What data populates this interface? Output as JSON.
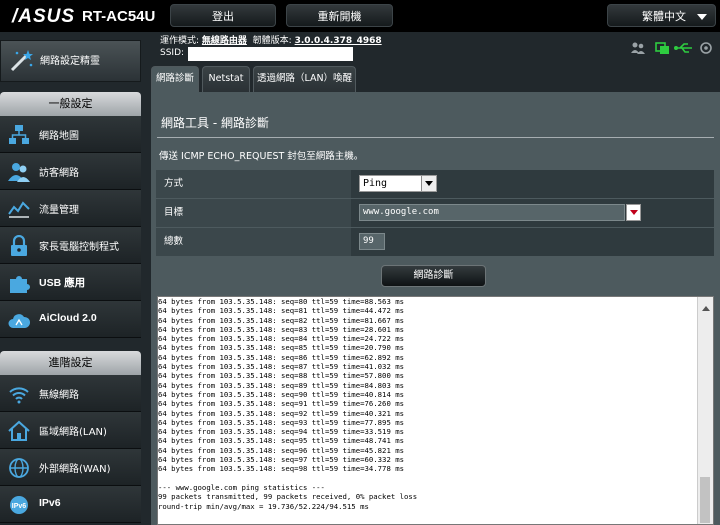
{
  "header": {
    "logo": "/ASUS",
    "model": "RT-AC54U",
    "logout_label": "登出",
    "reboot_label": "重新開機",
    "language": "繁體中文"
  },
  "info": {
    "mode_label": "運作模式:",
    "mode_value": "無線路由器",
    "firmware_label": "韌體版本:",
    "firmware_value": "3.0.0.4.378_4968",
    "ssid_label": "SSID:"
  },
  "sidebar": {
    "qis_label": "網路設定精靈",
    "general_header": "一般設定",
    "general_items": [
      {
        "label": "網路地圖",
        "icon": "network-map-icon"
      },
      {
        "label": "訪客網路",
        "icon": "guest-network-icon"
      },
      {
        "label": "流量管理",
        "icon": "traffic-manager-icon"
      },
      {
        "label": "家長電腦控制程式",
        "icon": "parental-control-icon"
      },
      {
        "label": "USB 應用",
        "icon": "usb-puzzle-icon"
      },
      {
        "label": "AiCloud 2.0",
        "icon": "aicloud-icon"
      }
    ],
    "advanced_header": "進階設定",
    "advanced_items": [
      {
        "label": "無線網路",
        "icon": "wireless-icon"
      },
      {
        "label": "區域網路(LAN)",
        "icon": "home-lan-icon"
      },
      {
        "label": "外部網路(WAN)",
        "icon": "globe-wan-icon"
      },
      {
        "label": "IPv6",
        "icon": "ipv6-icon"
      }
    ]
  },
  "tabs": [
    "網路診斷",
    "Netstat",
    "透過網路（LAN）喚醒"
  ],
  "main": {
    "title": "網路工具 - 網路診斷",
    "description": "傳送 ICMP ECHO_REQUEST 封包至網路主機。",
    "method_label": "方式",
    "method_value": "Ping",
    "target_label": "目標",
    "target_value": "www.google.com",
    "count_label": "總數",
    "count_value": "99",
    "diagnose_button": "網路診斷"
  },
  "console_lines": [
    "64 bytes from 103.5.35.148: seq=80 ttl=59 time=88.563 ms",
    "64 bytes from 103.5.35.148: seq=81 ttl=59 time=44.472 ms",
    "64 bytes from 103.5.35.148: seq=82 ttl=59 time=81.667 ms",
    "64 bytes from 103.5.35.148: seq=83 ttl=59 time=28.601 ms",
    "64 bytes from 103.5.35.148: seq=84 ttl=59 time=24.722 ms",
    "64 bytes from 103.5.35.148: seq=85 ttl=59 time=20.790 ms",
    "64 bytes from 103.5.35.148: seq=86 ttl=59 time=62.892 ms",
    "64 bytes from 103.5.35.148: seq=87 ttl=59 time=41.032 ms",
    "64 bytes from 103.5.35.148: seq=88 ttl=59 time=57.800 ms",
    "64 bytes from 103.5.35.148: seq=89 ttl=59 time=84.803 ms",
    "64 bytes from 103.5.35.148: seq=90 ttl=59 time=40.814 ms",
    "64 bytes from 103.5.35.148: seq=91 ttl=59 time=76.260 ms",
    "64 bytes from 103.5.35.148: seq=92 ttl=59 time=40.321 ms",
    "64 bytes from 103.5.35.148: seq=93 ttl=59 time=77.895 ms",
    "64 bytes from 103.5.35.148: seq=94 ttl=59 time=33.519 ms",
    "64 bytes from 103.5.35.148: seq=95 ttl=59 time=48.741 ms",
    "64 bytes from 103.5.35.148: seq=96 ttl=59 time=45.821 ms",
    "64 bytes from 103.5.35.148: seq=97 ttl=59 time=60.332 ms",
    "64 bytes from 103.5.35.148: seq=98 ttl=59 time=34.778 ms",
    "",
    "--- www.google.com ping statistics ---",
    "99 packets transmitted, 99 packets received, 0% packet loss",
    "round-trip min/avg/max = 19.736/52.224/94.515 ms"
  ],
  "colors": {
    "background": "#21282c",
    "panel": "#4d5a5e",
    "accent_green": "#2ecc40",
    "alert_red": "#c0001b"
  }
}
